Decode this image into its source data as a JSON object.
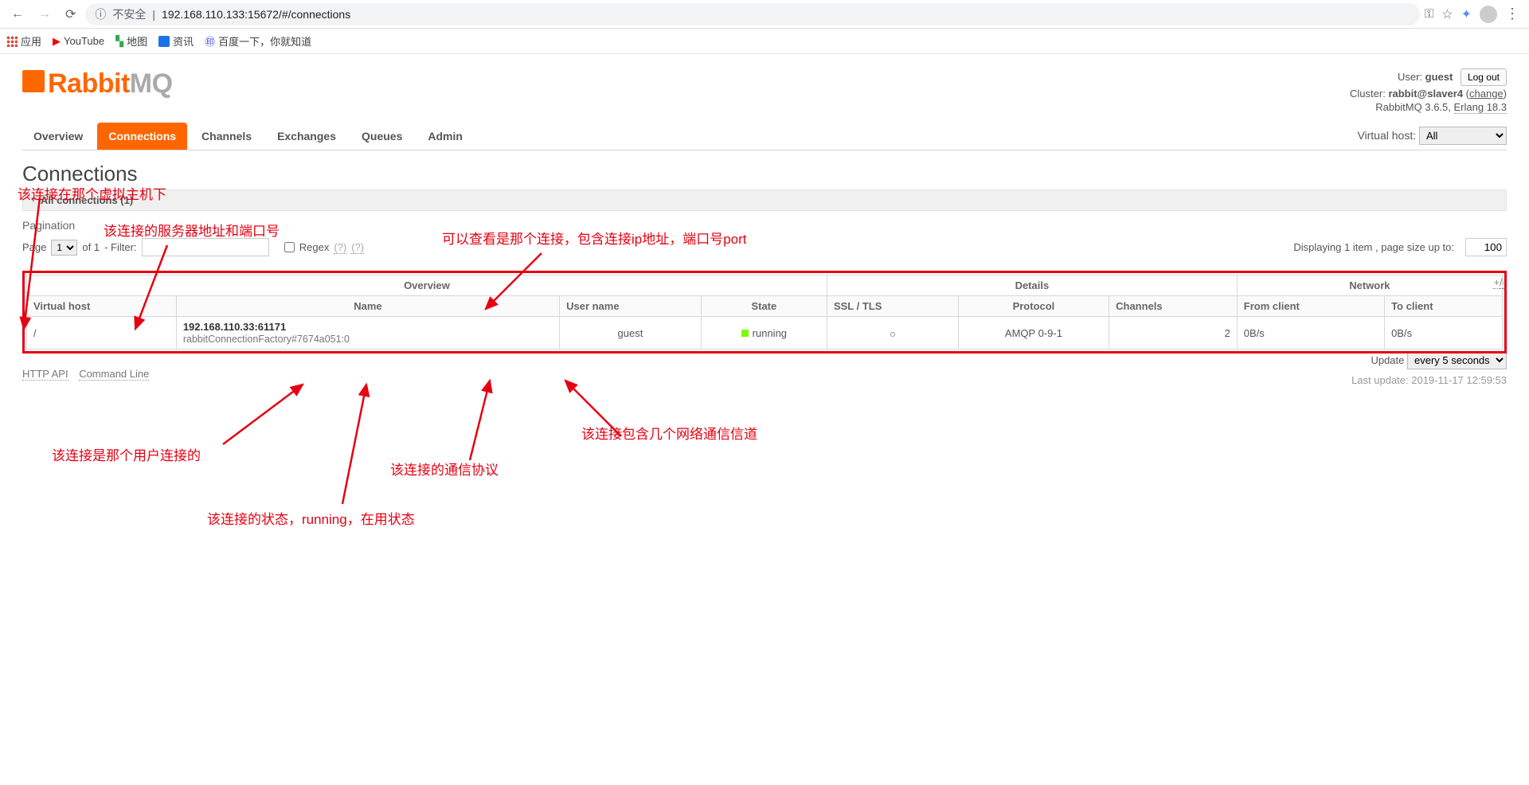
{
  "browser": {
    "insecure_label": "不安全",
    "url": "192.168.110.133:15672/#/connections"
  },
  "bookmarks": {
    "apps": "应用",
    "youtube": "YouTube",
    "maps": "地图",
    "zixun": "资讯",
    "baidu": "百度一下，你就知道"
  },
  "logo": {
    "rabbit": "Rabbit",
    "mq": "MQ"
  },
  "header_right": {
    "user_label": "User:",
    "user": "guest",
    "cluster_label": "Cluster:",
    "cluster": "rabbit@slaver4",
    "change": "change",
    "version": "RabbitMQ 3.6.5,",
    "erlang": "Erlang 18.3",
    "logout": "Log out"
  },
  "tabs": {
    "overview": "Overview",
    "connections": "Connections",
    "channels": "Channels",
    "exchanges": "Exchanges",
    "queues": "Queues",
    "admin": "Admin",
    "vhost_label": "Virtual host:",
    "vhost_all": "All"
  },
  "page_title": "Connections",
  "section": {
    "all_conn": "All connections (1)"
  },
  "pagination": {
    "label": "Pagination",
    "page": "Page",
    "page_val": "1",
    "of": "of 1",
    "filter": "- Filter:",
    "regex": "Regex",
    "qm": "(?)",
    "display": "Displaying 1 item , page size up to:",
    "pgsize": "100"
  },
  "table": {
    "groups": {
      "overview": "Overview",
      "details": "Details",
      "network": "Network"
    },
    "cols": {
      "vhost": "Virtual host",
      "name": "Name",
      "user": "User name",
      "state": "State",
      "ssl": "SSL / TLS",
      "protocol": "Protocol",
      "channels": "Channels",
      "from_client": "From client",
      "to_client": "To client"
    },
    "row": {
      "vhost": "/",
      "name": "192.168.110.33:61171",
      "name_sub": "rabbitConnectionFactory#7674a051:0",
      "user": "guest",
      "state": "running",
      "protocol": "AMQP 0-9-1",
      "channels": "2",
      "from_client": "0B/s",
      "to_client": "0B/s"
    },
    "plus": "+",
    "slash": "/",
    "minus": "-"
  },
  "footer": {
    "http_api": "HTTP API",
    "cmd": "Command Line"
  },
  "update": {
    "label": "Update",
    "interval": "every 5 seconds",
    "last": "Last update: 2019-11-17 12:59:53"
  },
  "annotations": {
    "vhost": "该连接在那个虚拟主机下",
    "name": "该连接的服务器地址和端口号",
    "top": "可以查看是那个连接，包含连接ip地址，端口号port",
    "user": "该连接是那个用户连接的",
    "state": "该连接的状态，running，在用状态",
    "protocol": "该连接的通信协议",
    "channels": "该连接包含几个网络通信信道"
  }
}
